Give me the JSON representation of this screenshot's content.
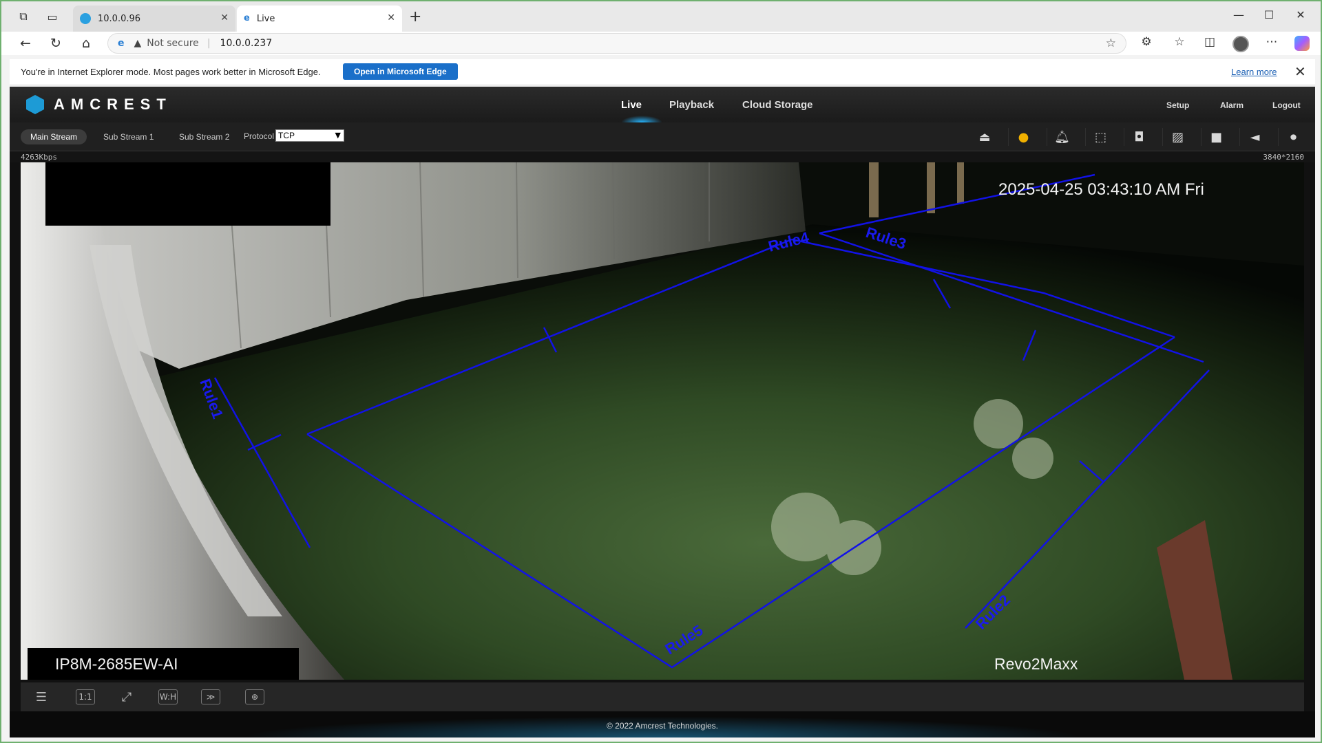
{
  "browser": {
    "tabs": [
      {
        "label": "10.0.0.96",
        "active": false
      },
      {
        "label": "Live",
        "active": true
      }
    ],
    "address": {
      "security": "Not secure",
      "url": "10.0.0.237"
    },
    "ie_banner": {
      "message": "You're in Internet Explorer mode. Most pages work better in Microsoft Edge.",
      "open_button": "Open in Microsoft Edge",
      "learn_more": "Learn more"
    }
  },
  "app": {
    "brand": "AMCREST",
    "nav": {
      "live": "Live",
      "playback": "Playback",
      "cloud": "Cloud Storage"
    },
    "top_links": {
      "setup": "Setup",
      "alarm": "Alarm",
      "logout": "Logout"
    },
    "streams": {
      "main": "Main Stream",
      "sub1": "Sub Stream 1",
      "sub2": "Sub Stream 2"
    },
    "protocol": {
      "label": "Protocol",
      "value": "TCP"
    },
    "status": {
      "bitrate": "4263Kbps",
      "resolution": "3840*2160"
    },
    "video": {
      "timestamp": "2025-04-25 03:43:10 AM Fri",
      "camera_name": "Revo2Maxx",
      "model": "IP8M-2685EW-AI",
      "rules": [
        "Rule1",
        "Rule2",
        "Rule3",
        "Rule4",
        "Rule5"
      ],
      "rule_color": "#1010e0"
    },
    "bottom_tools": {
      "ratio": "1:1",
      "wh": "W:H"
    },
    "footer": "© 2022 Amcrest Technologies."
  },
  "colors": {
    "accent": "#1d9bd6",
    "ie_button": "#1a6fc9",
    "alarm_icon": "#f0b000"
  }
}
